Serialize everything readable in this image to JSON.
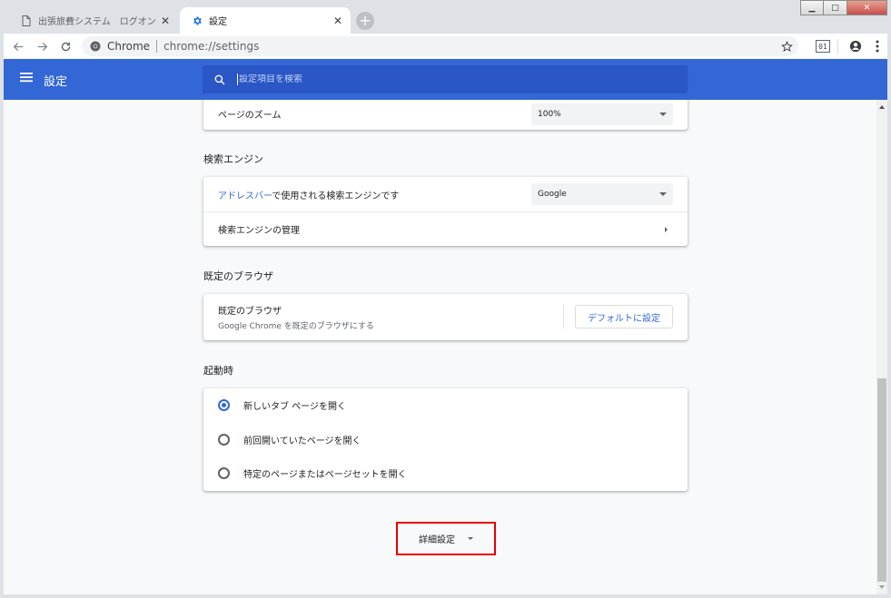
{
  "tabs": [
    {
      "title": "出張旅費システム　ログオン",
      "icon": "document-icon",
      "active": false
    },
    {
      "title": "設定",
      "icon": "gear-icon",
      "active": true
    }
  ],
  "window_controls": {
    "minimize": "▁",
    "maximize": "□",
    "close": "✕"
  },
  "omnibox": {
    "site": "Chrome",
    "url": "chrome://settings"
  },
  "extension_badge": "01",
  "header": {
    "title": "設定",
    "search_placeholder": "設定項目を検索"
  },
  "page_zoom": {
    "label": "ページのズーム",
    "value": "100%"
  },
  "search_engine": {
    "section_title": "検索エンジン",
    "row1_link": "アドレスバー",
    "row1_text": "で使用される検索エンジンです",
    "row1_value": "Google",
    "row2_label": "検索エンジンの管理"
  },
  "default_browser": {
    "section_title": "既定のブラウザ",
    "title": "既定のブラウザ",
    "subtitle": "Google Chrome を既定のブラウザにする",
    "button": "デフォルトに設定"
  },
  "startup": {
    "section_title": "起動時",
    "options": [
      {
        "label": "新しいタブ ページを開く",
        "checked": true
      },
      {
        "label": "前回開いていたページを開く",
        "checked": false
      },
      {
        "label": "特定のページまたはページセットを開く",
        "checked": false
      }
    ]
  },
  "advanced": {
    "label": "詳細設定"
  },
  "colors": {
    "header_blue": "#3367d6",
    "highlight_red": "#e60000",
    "link_blue": "#3367d6"
  }
}
